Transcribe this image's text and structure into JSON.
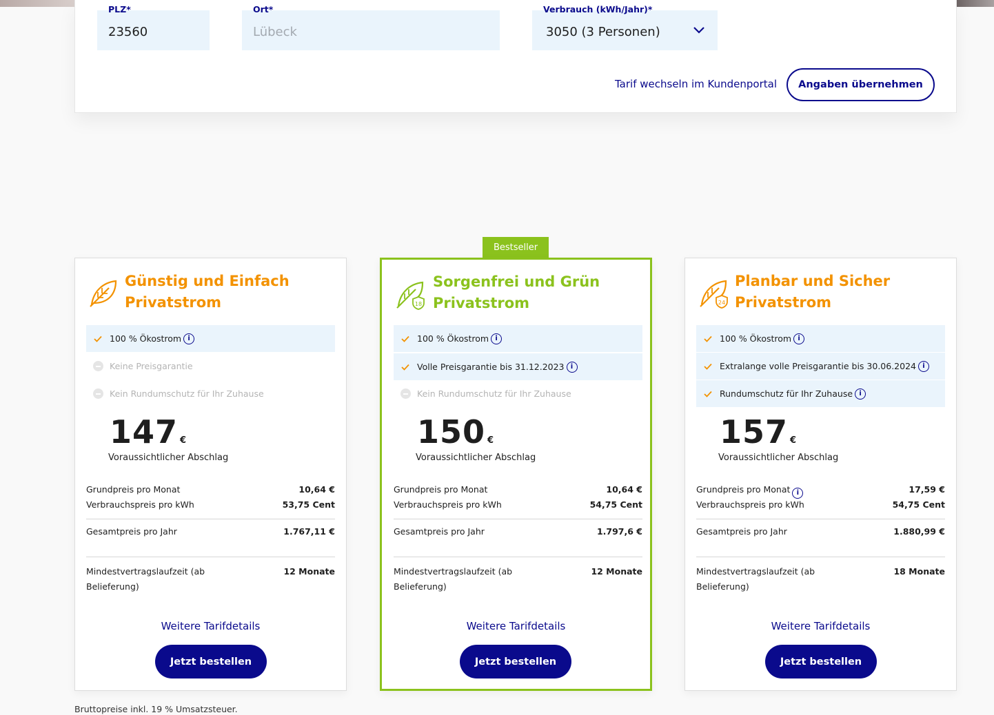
{
  "form": {
    "plz": {
      "label": "PLZ*",
      "value": "23560"
    },
    "ort": {
      "label": "Ort*",
      "placeholder": "Lübeck"
    },
    "verbrauch": {
      "label": "Verbrauch (kWh/Jahr)*",
      "value": "3050 (3 Personen)"
    },
    "portal_link": "Tarif wechseln im Kundenportal",
    "apply_button": "Angaben übernehmen"
  },
  "badge": "Bestseller",
  "colors": {
    "navy": "#0a0a8c",
    "orange": "#f39200",
    "green": "#8bc21d",
    "field_bg": "#eaf4fc"
  },
  "tariffs": [
    {
      "title_line1": "Günstig und Einfach",
      "title_line2": "Privatstrom",
      "features": [
        {
          "label": "100 % Ökostrom",
          "included": true
        },
        {
          "label": "Keine Preisgarantie",
          "included": false
        },
        {
          "label": "Kein Rundumschutz für Ihr Zuhause",
          "included": false
        }
      ],
      "price": "147",
      "currency": "€",
      "price_label": "Voraussichtlicher Abschlag",
      "grundpreis_label": "Grundpreis pro Monat",
      "grundpreis": "10,64 €",
      "verbrauchspreis_label": "Verbrauchspreis pro kWh",
      "verbrauchspreis": "53,75 Cent",
      "gesamtpreis_label": "Gesamtpreis pro Jahr",
      "gesamtpreis": "1.767,11 €",
      "laufzeit_line1": "Mindestvertragslaufzeit (ab",
      "laufzeit_line2": "Belieferung)",
      "laufzeit": "12 Monate",
      "details_link": "Weitere Tarifdetails",
      "order_button": "Jetzt bestellen"
    },
    {
      "title_line1": "Sorgenfrei und Grün",
      "title_line2": "Privatstrom",
      "icon_number": "18",
      "features": [
        {
          "label": "100 % Ökostrom",
          "included": true
        },
        {
          "label": "Volle Preisgarantie bis 31.12.2023",
          "included": true
        },
        {
          "label": "Kein Rundumschutz für Ihr Zuhause",
          "included": false
        }
      ],
      "price": "150",
      "currency": "€",
      "price_label": "Voraussichtlicher Abschlag",
      "grundpreis_label": "Grundpreis pro Monat",
      "grundpreis": "10,64 €",
      "verbrauchspreis_label": "Verbrauchspreis pro kWh",
      "verbrauchspreis": "54,75 Cent",
      "gesamtpreis_label": "Gesamtpreis pro Jahr",
      "gesamtpreis": "1.797,6 €",
      "laufzeit_line1": "Mindestvertragslaufzeit (ab",
      "laufzeit_line2": "Belieferung)",
      "laufzeit": "12 Monate",
      "details_link": "Weitere Tarifdetails",
      "order_button": "Jetzt bestellen"
    },
    {
      "title_line1": "Planbar und Sicher",
      "title_line2": "Privatstrom",
      "icon_number": "24",
      "features": [
        {
          "label": "100 % Ökostrom",
          "included": true
        },
        {
          "label": "Extralange volle Preisgarantie bis 30.06.2024",
          "included": true
        },
        {
          "label": "Rundumschutz für Ihr Zuhause",
          "included": true
        }
      ],
      "price": "157",
      "currency": "€",
      "price_label": "Voraussichtlicher Abschlag",
      "grundpreis_label": "Grundpreis pro Monat",
      "grundpreis": "17,59 €",
      "verbrauchspreis_label": "Verbrauchspreis pro kWh",
      "verbrauchspreis": "54,75 Cent",
      "gesamtpreis_label": "Gesamtpreis pro Jahr",
      "gesamtpreis": "1.880,99 €",
      "laufzeit_line1": "Mindestvertragslaufzeit (ab",
      "laufzeit_line2": "Belieferung)",
      "laufzeit": "18 Monate",
      "details_link": "Weitere Tarifdetails",
      "order_button": "Jetzt bestellen"
    }
  ],
  "footnote": "Bruttopreise inkl. 19 % Umsatzsteuer."
}
